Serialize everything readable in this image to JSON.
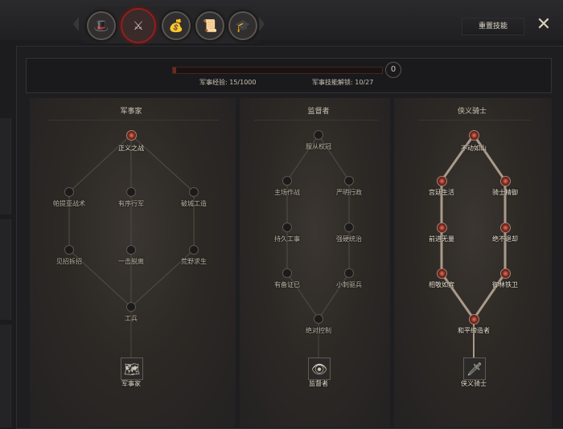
{
  "header": {
    "reset_label": "重置技能",
    "close_icon": "close-icon",
    "categories": [
      {
        "icon": "general-portrait-icon",
        "glyph": "🎩"
      },
      {
        "icon": "military-crossed-swords-icon",
        "glyph": "⚔",
        "active": true
      },
      {
        "icon": "treasure-chest-icon",
        "glyph": "💰"
      },
      {
        "icon": "scroll-quill-icon",
        "glyph": "📜"
      },
      {
        "icon": "hat-icon",
        "glyph": "🎓"
      }
    ]
  },
  "progress": {
    "xp_label": "军事经验: 15/1000",
    "xp_fraction": 0.015,
    "unlock_label": "军事技能解锁: 10/27",
    "points": "0"
  },
  "colors": {
    "lit_edge": "#a89a8c",
    "dim_edge": "#4a4641",
    "active_red": "#8e2020"
  },
  "trees": [
    {
      "title": "军事家",
      "class_name": "军事家",
      "class_icon": "strategist-map-icon",
      "class_glyph": "🗺",
      "nodes": [
        {
          "id": "a1",
          "label": "正义之战",
          "lit": true
        },
        {
          "id": "a2",
          "label": "帕提亚战术",
          "lit": false
        },
        {
          "id": "a3",
          "label": "有序行军",
          "lit": false
        },
        {
          "id": "a4",
          "label": "破城工造",
          "lit": false
        },
        {
          "id": "a5",
          "label": "见招拆招",
          "lit": false
        },
        {
          "id": "a6",
          "label": "一击脱离",
          "lit": false
        },
        {
          "id": "a7",
          "label": "荒野求生",
          "lit": false
        },
        {
          "id": "a8",
          "label": "工兵",
          "lit": false
        }
      ]
    },
    {
      "title": "监督者",
      "class_name": "监督者",
      "class_icon": "overseer-eye-icon",
      "class_glyph": "👁",
      "nodes": [
        {
          "id": "b1",
          "label": "服从权冠",
          "lit": false
        },
        {
          "id": "b2",
          "label": "主场作战",
          "lit": false
        },
        {
          "id": "b3",
          "label": "严明行政",
          "lit": false
        },
        {
          "id": "b4",
          "label": "持久工事",
          "lit": false
        },
        {
          "id": "b5",
          "label": "强硬统治",
          "lit": false
        },
        {
          "id": "b6",
          "label": "有备证已",
          "lit": false
        },
        {
          "id": "b7",
          "label": "小刺驱兵",
          "lit": false
        },
        {
          "id": "b8",
          "label": "绝对控制",
          "lit": false
        }
      ]
    },
    {
      "title": "侠义骑士",
      "class_name": "侠义骑士",
      "class_icon": "knight-sword-icon",
      "class_glyph": "🗡",
      "nodes": [
        {
          "id": "c1",
          "label": "不动如山",
          "lit": true
        },
        {
          "id": "c2",
          "label": "宫廷生活",
          "lit": true
        },
        {
          "id": "c3",
          "label": "骑士精御",
          "lit": true
        },
        {
          "id": "c4",
          "label": "前进无量",
          "lit": true
        },
        {
          "id": "c5",
          "label": "绝不退却",
          "lit": true
        },
        {
          "id": "c6",
          "label": "相敬如宾",
          "lit": true
        },
        {
          "id": "c7",
          "label": "御林铁卫",
          "lit": true
        },
        {
          "id": "c8",
          "label": "和平缔造者",
          "lit": true
        }
      ]
    }
  ]
}
